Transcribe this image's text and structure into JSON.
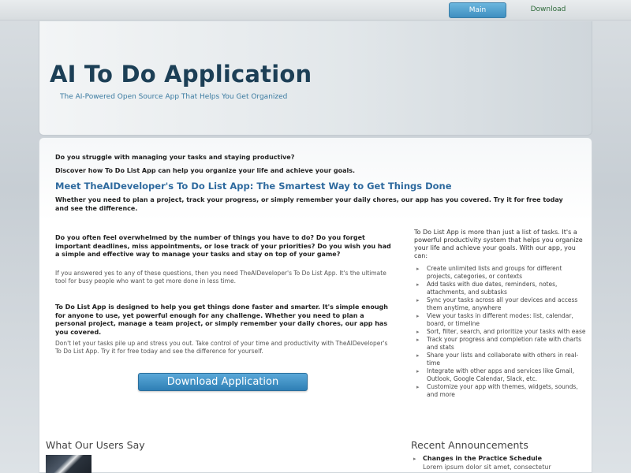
{
  "nav": {
    "main": "Main",
    "download": "Download"
  },
  "header": {
    "title": "AI To Do Application",
    "subtitle": "The AI-Powered Open Source App That Helps You Get Organized"
  },
  "intro": {
    "q1": "Do you struggle with managing your tasks and staying productive?",
    "q2": "Discover how To Do List App can help you organize your life and achieve your goals.",
    "heading": "Meet TheAIDeveloper's To Do List App: The Smartest Way to Get Things Done",
    "lead": "Whether you need to plan a project, track your progress, or simply remember your daily chores, our app has you covered. Try it for free today and see the difference."
  },
  "left": {
    "p1": "Do you often feel overwhelmed by the number of things you have to do? Do you forget important deadlines, miss appointments, or lose track of your priorities? Do you wish you had a simple and effective way to manage your tasks and stay on top of your game?",
    "p2": "If you answered yes to any of these questions, then you need TheAIDeveloper's To Do List App. It's the ultimate tool for busy people who want to get more done in less time.",
    "p3": "To Do List App is designed to help you get things done faster and smarter. It's simple enough for anyone to use, yet powerful enough for any challenge. Whether you need to plan a personal project, manage a team project, or simply remember your daily chores, our app has you covered.",
    "p4": "Don't let your tasks pile up and stress you out. Take control of your time and productivity with TheAIDeveloper's To Do List App. Try it for free today and see the difference for yourself.",
    "button": "Download Application"
  },
  "right": {
    "intro": "To Do List App is more than just a list of tasks. It's a powerful productivity system that helps you organize your life and achieve your goals. With our app, you can:",
    "features": [
      "Create unlimited lists and groups for different projects, categories, or contexts",
      "Add tasks with due dates, reminders, notes, attachments, and subtasks",
      "Sync your tasks across all your devices and access them anytime, anywhere",
      "View your tasks in different modes: list, calendar, board, or timeline",
      "Sort, filter, search, and prioritize your tasks with ease",
      "Track your progress and completion rate with charts and stats",
      "Share your lists and collaborate with others in real-time",
      "Integrate with other apps and services like Gmail, Outlook, Google Calendar, Slack, etc.",
      "Customize your app with themes, widgets, sounds, and more"
    ]
  },
  "users": {
    "title": "What Our Users Say"
  },
  "announcements": {
    "title": "Recent Announcements",
    "item_title": "Changes in the Practice Schedule",
    "item_text": "Lorem ipsum dolor sit amet, consectetur"
  }
}
